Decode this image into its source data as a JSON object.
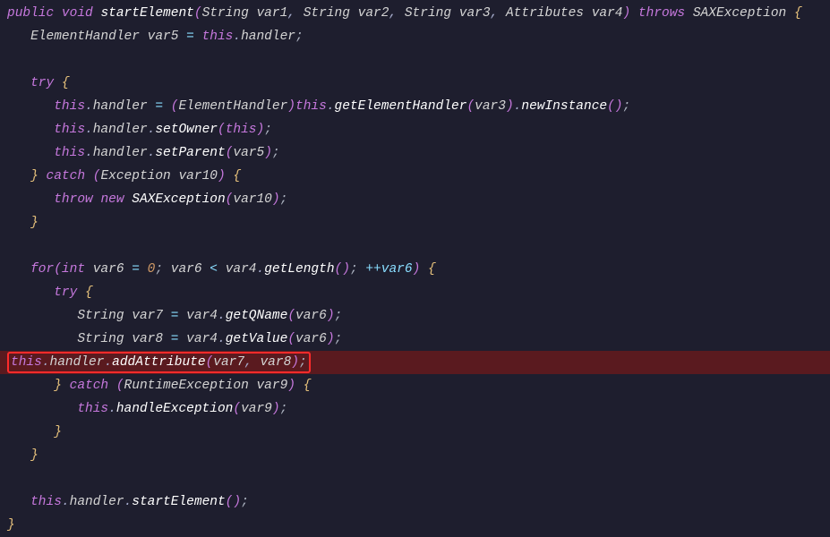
{
  "code": {
    "method_signature": {
      "public": "public",
      "void": "void",
      "name": "startElement",
      "p1type": "String",
      "p1": "var1",
      "p2type": "String",
      "p2": "var2",
      "p3type": "String",
      "p3": "var3",
      "p4type": "Attributes",
      "p4": "var4",
      "throws": "throws",
      "exctype": "SAXException"
    },
    "l2": {
      "type": "ElementHandler",
      "var": "var5",
      "this": "this",
      "field": "handler"
    },
    "try": "try",
    "l4": {
      "this": "this",
      "field": "handler",
      "cast": "ElementHandler",
      "this2": "this",
      "m1": "getElementHandler",
      "arg": "var3",
      "m2": "newInstance"
    },
    "l5": {
      "this": "this",
      "field": "handler",
      "m": "setOwner",
      "this2": "this"
    },
    "l6": {
      "this": "this",
      "field": "handler",
      "m": "setParent",
      "arg": "var5"
    },
    "catch": "catch",
    "l7": {
      "type": "Exception",
      "var": "var10"
    },
    "l8": {
      "throw": "throw",
      "new": "new",
      "type": "SAXException",
      "arg": "var10"
    },
    "forr": {
      "for": "for",
      "int": "int",
      "var": "var6",
      "zero": "0",
      "cond_var": "var6",
      "cond_obj": "var4",
      "cond_m": "getLength",
      "inc": "++var6"
    },
    "l10": {
      "type": "String",
      "var": "var7",
      "obj": "var4",
      "m": "getQName",
      "arg": "var6"
    },
    "l11": {
      "type": "String",
      "var": "var8",
      "obj": "var4",
      "m": "getValue",
      "arg": "var6"
    },
    "hl": {
      "this": "this",
      "field": "handler",
      "m": "addAttribute",
      "a1": "var7",
      "a2": "var8"
    },
    "l13": {
      "type": "RuntimeException",
      "var": "var9"
    },
    "l14": {
      "this": "this",
      "m": "handleException",
      "arg": "var9"
    },
    "last": {
      "this": "this",
      "field": "handler",
      "m": "startElement"
    }
  }
}
